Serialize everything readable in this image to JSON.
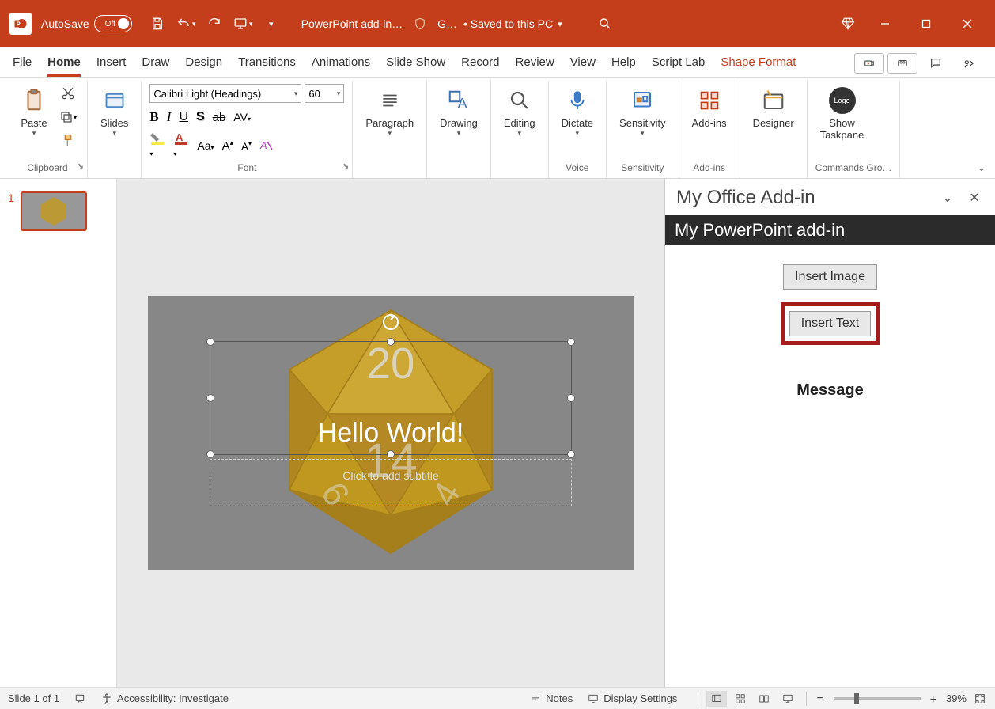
{
  "titlebar": {
    "autosave_label": "AutoSave",
    "autosave_state": "Off",
    "document_name": "PowerPoint add-in…",
    "save_location_short": "G…",
    "save_status": "• Saved to this PC"
  },
  "tabs": {
    "file": "File",
    "home": "Home",
    "insert": "Insert",
    "draw": "Draw",
    "design": "Design",
    "transitions": "Transitions",
    "animations": "Animations",
    "slide_show": "Slide Show",
    "record": "Record",
    "review": "Review",
    "view": "View",
    "help": "Help",
    "script_lab": "Script Lab",
    "shape_format": "Shape Format"
  },
  "ribbon": {
    "clipboard": {
      "paste": "Paste",
      "label": "Clipboard"
    },
    "slides": {
      "slides": "Slides"
    },
    "font": {
      "name": "Calibri Light (Headings)",
      "size": "60",
      "label": "Font"
    },
    "paragraph": {
      "label": "Paragraph"
    },
    "drawing": {
      "label": "Drawing"
    },
    "editing": {
      "label": "Editing"
    },
    "dictate": {
      "label": "Dictate",
      "group": "Voice"
    },
    "sensitivity": {
      "label": "Sensitivity",
      "group": "Sensitivity"
    },
    "addins": {
      "label": "Add-ins",
      "group": "Add-ins"
    },
    "designer": {
      "label": "Designer"
    },
    "taskpane_btn": {
      "line1": "Show",
      "line2": "Taskpane",
      "group": "Commands Gro…",
      "logo": "Logo"
    }
  },
  "thumbnail": {
    "number": "1"
  },
  "slide": {
    "title": "Hello World!",
    "subtitle_placeholder": "Click to add subtitle"
  },
  "taskpane": {
    "title": "My Office Add-in",
    "subtitle": "My PowerPoint add-in",
    "insert_image": "Insert Image",
    "insert_text": "Insert Text",
    "message": "Message"
  },
  "statusbar": {
    "slide_info": "Slide 1 of 1",
    "accessibility": "Accessibility: Investigate",
    "notes": "Notes",
    "display_settings": "Display Settings",
    "zoom": "39%"
  },
  "colors": {
    "brand": "#c43e1c",
    "d20": "#c59a17"
  }
}
